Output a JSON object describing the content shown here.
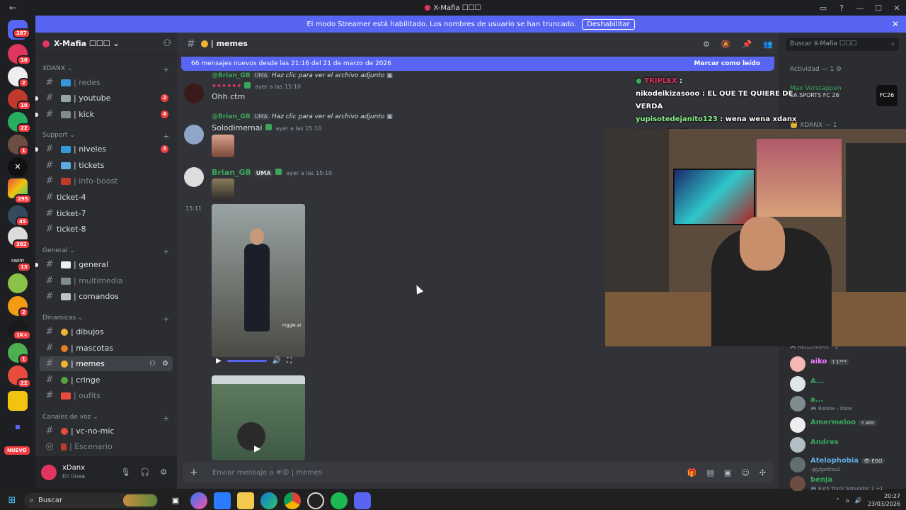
{
  "window": {
    "title": "X-Mafia ☐☐☐",
    "back": "←",
    "controls": [
      "▭",
      "?",
      "—",
      "☐",
      "✕"
    ]
  },
  "streamer_bar": {
    "text": "El modo Streamer está habilitado. Los nombres de usuario se han truncado.",
    "button": "Deshabilitar",
    "close": "✕"
  },
  "guild_badges": [
    "287",
    "10",
    "2",
    "19",
    "22",
    "1",
    "295",
    "45",
    "382",
    "13",
    "2",
    "1K+",
    "1",
    "22"
  ],
  "new_label": "NUEVO",
  "server": {
    "name": "X-Mafia ☐☐☐",
    "chevron": "⌄"
  },
  "categories": [
    {
      "name": "XDANX ⌄"
    },
    {
      "name": "Support ⌄"
    },
    {
      "name": "General ⌄"
    },
    {
      "name": "Dinamicas ⌄"
    },
    {
      "name": "Canales de voz ⌄"
    }
  ],
  "channels": [
    {
      "label": "| redes",
      "muted": true
    },
    {
      "label": "| youtube",
      "count": "2"
    },
    {
      "label": "| kick",
      "count": "4"
    },
    {
      "label": "| niveles",
      "count": "3"
    },
    {
      "label": "| tickets"
    },
    {
      "label": "| info-boost",
      "muted": true
    },
    {
      "label": "ticket-4"
    },
    {
      "label": "ticket-7"
    },
    {
      "label": "ticket-8"
    },
    {
      "label": "| general"
    },
    {
      "label": "| multimedia",
      "muted": true
    },
    {
      "label": "| comandos"
    },
    {
      "label": "| dibujos"
    },
    {
      "label": "| mascotas"
    },
    {
      "label": "| memes",
      "active": true
    },
    {
      "label": "| cringe"
    },
    {
      "label": "| oufits",
      "muted": true
    },
    {
      "label": "| vc-no-mic"
    },
    {
      "label": "| Escenario",
      "muted": true
    }
  ],
  "user": {
    "name": "xDanx",
    "status": "En línea"
  },
  "channel": {
    "name": "| memes"
  },
  "new_messages": {
    "text": "66 mensajes nuevos desde las 21:16 del 21 de marzo de 2026",
    "mark": "Marcar como leído"
  },
  "messages": [
    {
      "reply_name": "@Brian_GB",
      "reply_tag": "UMA",
      "reply_text": "Haz clic para ver el archivo adjunto",
      "author": "••••••",
      "time": "ayer a las 15:10",
      "content": "Ohh ctm",
      "author_color": "#e0355f"
    },
    {
      "reply_name": "@Brian_GB",
      "reply_tag": "UMA",
      "reply_text": "Haz clic para ver el archivo adjunto",
      "author": "Solodimemai",
      "time": "ayer a las 15:10",
      "author_color": "#dbdee1"
    },
    {
      "author": "Brian_GB",
      "tag": "UMA",
      "time": "ayer a las 15:10",
      "author_color": "#3ba55c"
    }
  ],
  "timestamp_side": "15:11",
  "video": {
    "watermark": "mggle ai",
    "play": "▶",
    "vol": "🔊",
    "full": "⛶"
  },
  "composer": {
    "placeholder": "Enviar mensaje a #😝 | memes",
    "plus": "+"
  },
  "search": {
    "placeholder": "Buscar X-Mafia ☐☐☐",
    "icon": "⌕"
  },
  "member_headers": [
    {
      "text": "Actividad — 1 ⚙"
    },
    {
      "text": "👑 XDANX — 1"
    }
  ],
  "activity": {
    "name": "Max Verstappen",
    "game": "EA SPORTS FC 26",
    "badge": "FC26"
  },
  "stream_chat": [
    {
      "user": "TRIPLEX",
      "text": ""
    },
    {
      "user": "nikodelkizasooo",
      "text": "EL QUE TE QUIERE DE VERDA"
    },
    {
      "user": "yupisotedejanito123",
      "text": "wena wena xdanx como estas??"
    }
  ],
  "members": [
    {
      "name": "aiko",
      "tag": "† 1***",
      "sub": "",
      "color": "#f47fff"
    },
    {
      "name": "A...",
      "tag": "",
      "sub": "",
      "color": "#3ba55c"
    },
    {
      "name": "a...",
      "tag": "",
      "sub": "🎮 Roblox - Xbox",
      "color": "#3ba55c"
    },
    {
      "name": "Amermeloo",
      "tag": "⚡.win",
      "sub": "",
      "color": "#3ba55c"
    },
    {
      "name": "Andres",
      "tag": "",
      "sub": "",
      "color": "#3ba55c"
    },
    {
      "name": "Atelophobia",
      "tag": "👁 EGO",
      "sub": ".gg/gatitos2",
      "color": "#5dade2"
    },
    {
      "name": "benja",
      "tag": "",
      "sub": "🎮 Euro Truck Simulator 2 +1",
      "color": "#3ba55c"
    }
  ],
  "helldivers": "🎮 HELLDIVERS™ 2",
  "taskbar": {
    "search": "Buscar",
    "time": "20:27",
    "date": "23/03/2026"
  }
}
